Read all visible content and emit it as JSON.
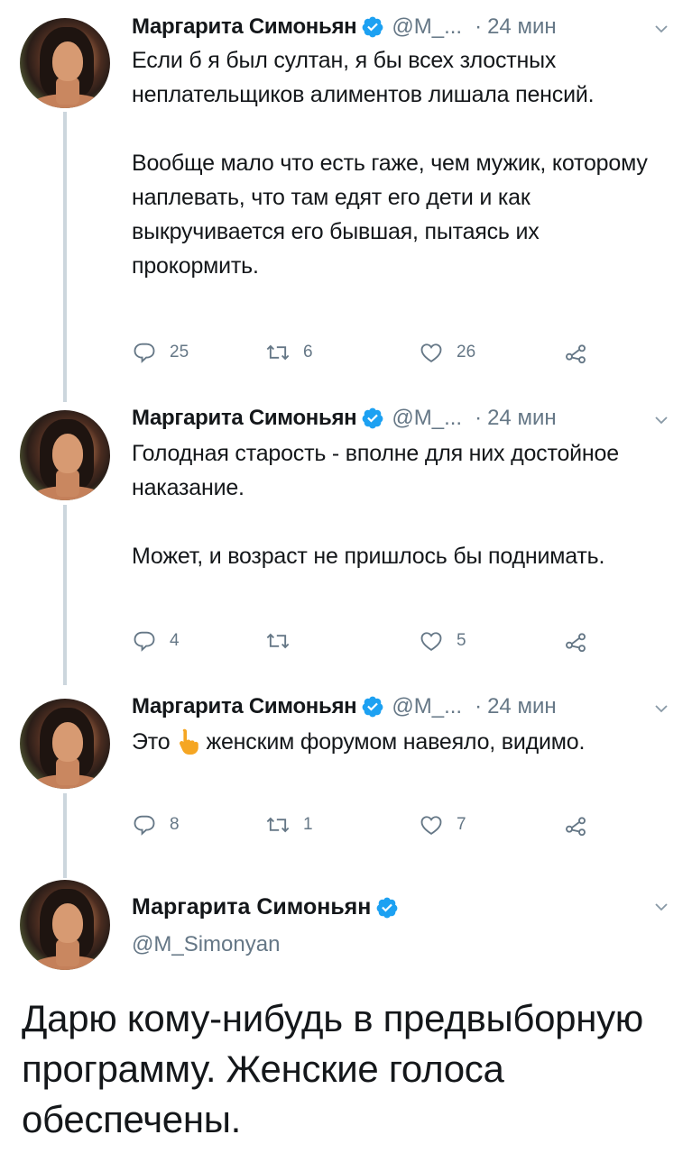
{
  "thread": [
    {
      "name": "Маргарита Симоньян",
      "handle": "@M_...",
      "time": "24 мин",
      "paragraphs": [
        "Если б я был султан, я бы всех злостных неплательщиков алиментов лишала пенсий.",
        "Вообще мало что есть гаже, чем мужик, которому наплевать, что там едят его дети и как выкручивается его бывшая, пытаясь их прокормить."
      ],
      "replies": "25",
      "retweets": "6",
      "likes": "26"
    },
    {
      "name": "Маргарита Симоньян",
      "handle": "@M_...",
      "time": "24 мин",
      "paragraphs": [
        "Голодная старость - вполне для них достойное наказание.",
        "Может, и возраст не пришлось бы поднимать."
      ],
      "replies": "4",
      "retweets": "",
      "likes": "5"
    },
    {
      "name": "Маргарита Симоньян",
      "handle": "@M_...",
      "time": "24 мин",
      "text_before_emoji": "Это",
      "emoji": "pointing-up-hand-emoji",
      "text_after_emoji": "женским форумом навеяло, видимо.",
      "replies": "8",
      "retweets": "1",
      "likes": "7"
    }
  ],
  "main_tweet": {
    "name": "Маргарита Симоньян",
    "handle": "@M_Simonyan",
    "text": "Дарю кому-нибудь в предвыборную программу. Женские голоса обеспечены."
  },
  "icons": {
    "reply": "reply-icon",
    "retweet": "retweet-icon",
    "like": "heart-icon",
    "share": "share-icon",
    "verified": "verified-badge-icon",
    "more": "chevron-down-icon"
  },
  "colors": {
    "verified_blue": "#1da1f2",
    "secondary_text": "#657786",
    "thread_line": "#ccd6dd"
  }
}
